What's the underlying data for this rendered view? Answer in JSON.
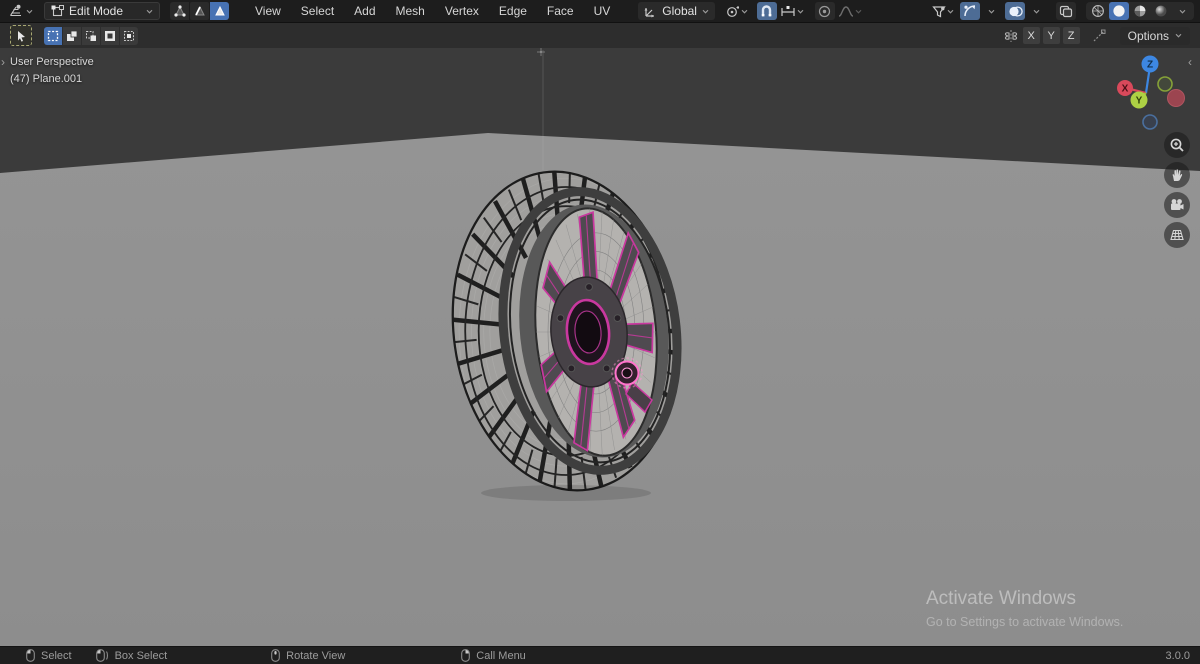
{
  "colors": {
    "accent_blue": "#4772b3",
    "selected_edge": "#c9389f",
    "selected_bright": "#ff74cc",
    "axis_x": "#d9495b",
    "axis_x_neg": "#9c4550",
    "axis_y": "#add144",
    "axis_z": "#3d87e2",
    "wall": "#3b3b3b",
    "floor": "#8d8d8d",
    "tire_dark": "#1c1c1c",
    "tread_gray": "#a09f9d",
    "rim_gray": "#b4b2af"
  },
  "topbar": {
    "editor_type": "3d-viewport",
    "mode": "Edit Mode",
    "select_modes": [
      "vertex",
      "edge",
      "face"
    ],
    "active_select_mode": "face",
    "menus": [
      "View",
      "Select",
      "Add",
      "Mesh",
      "Vertex",
      "Edge",
      "Face",
      "UV"
    ],
    "orientation": "Global"
  },
  "toolbar": {
    "active_tool": "select-box",
    "mirror_axes": [
      "X",
      "Y",
      "Z"
    ],
    "options_label": "Options"
  },
  "viewport": {
    "perspective_label": "User Perspective",
    "object_label": "(47) Plane.001",
    "gizmo": {
      "x": "X",
      "y": "Y",
      "z": "Z"
    },
    "scene_object": "wheel-with-tire-in-edit-mode"
  },
  "statusbar": {
    "items": [
      {
        "icon": "mouse-left",
        "label": "Select"
      },
      {
        "icon": "mouse-left-drag",
        "label": "Box Select"
      },
      {
        "icon": "mouse-middle",
        "label": "Rotate View"
      },
      {
        "icon": "mouse-right",
        "label": "Call Menu"
      }
    ],
    "version": "3.0.0"
  },
  "watermark": {
    "title": "Activate Windows",
    "subtitle": "Go to Settings to activate Windows."
  }
}
